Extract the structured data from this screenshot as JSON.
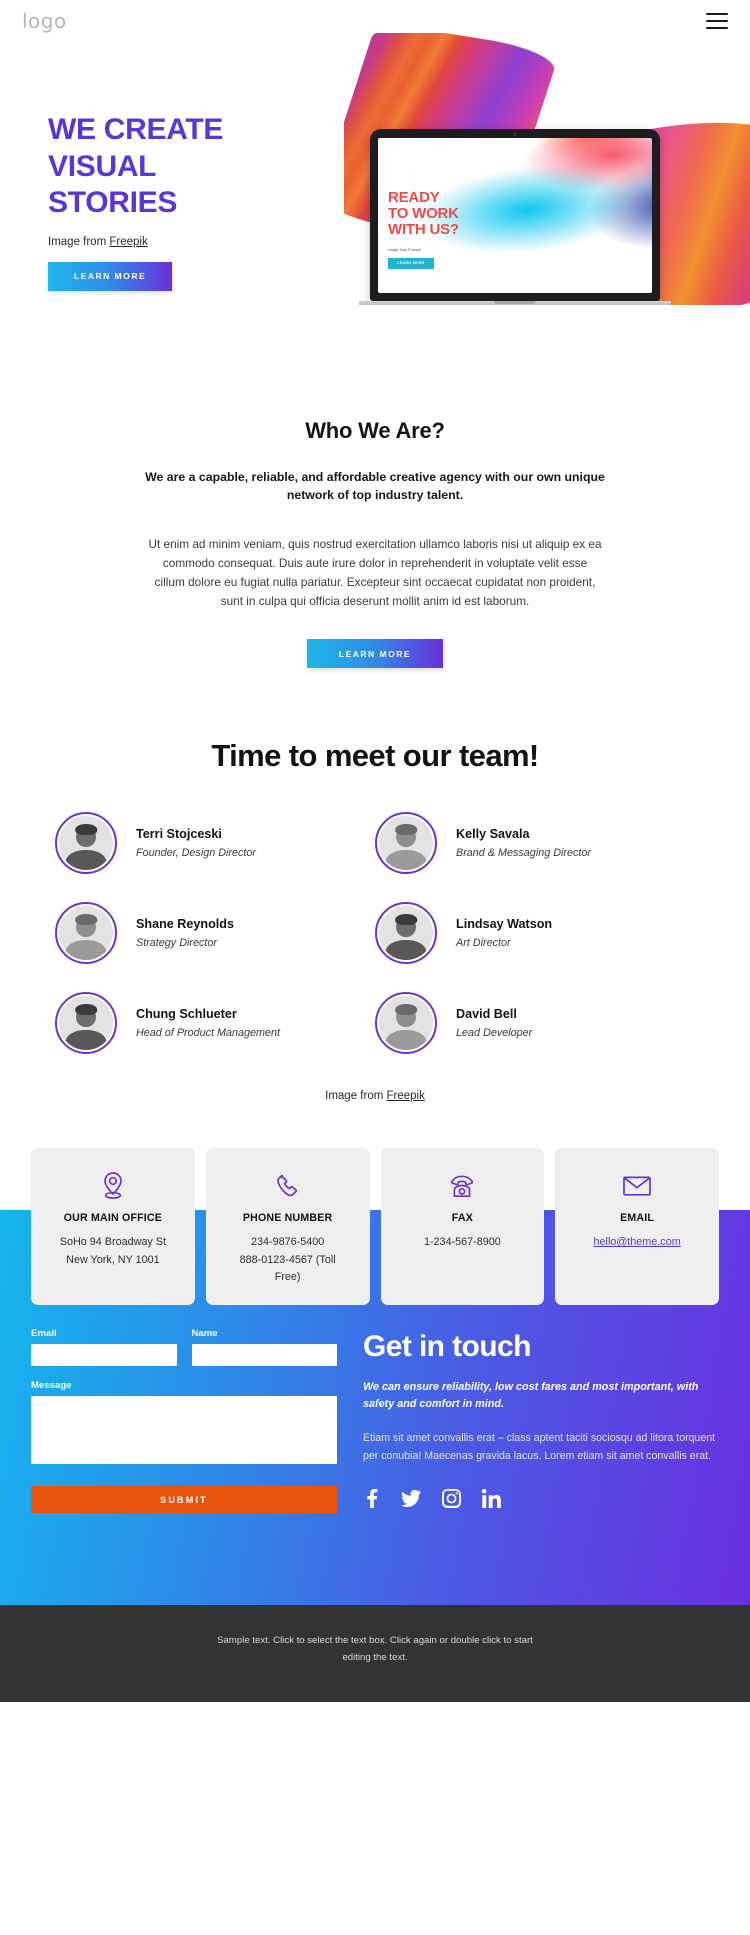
{
  "header": {
    "logo": "logo",
    "menu_icon": "hamburger-menu-icon"
  },
  "hero": {
    "title_line1": "WE CREATE",
    "title_line2": "VISUAL",
    "title_line3": "STORIES",
    "credit_prefix": "Image from ",
    "credit_link": "Freepik",
    "cta": "LEARN MORE",
    "accent_color": "#5b35d5",
    "device": {
      "screen_line1": "READY",
      "screen_line2": "TO WORK",
      "screen_line3": "WITH US?",
      "screen_credit": "Image from Freepik",
      "screen_button": "LEARN MORE"
    }
  },
  "about": {
    "heading": "Who We Are?",
    "lead": "We are a capable, reliable, and affordable creative agency with our own unique network of top industry talent.",
    "body": "Ut enim ad minim veniam, quis nostrud exercitation ullamco laboris nisi ut aliquip ex ea commodo consequat. Duis aute irure dolor in reprehenderit in voluptate velit esse cillum dolore eu fugiat nulla pariatur. Excepteur sint occaecat cupidatat non proident, sunt in culpa qui officia deserunt mollit anim id est laborum.",
    "cta": "LEARN MORE"
  },
  "team": {
    "heading": "Time to meet our team!",
    "credit_prefix": "Image from ",
    "credit_link": "Freepik",
    "ring_color": "#6a33d6",
    "members": [
      {
        "name": "Terri Stojceski",
        "role": "Founder, Design Director"
      },
      {
        "name": "Kelly Savala",
        "role": "Brand & Messaging Director"
      },
      {
        "name": "Shane Reynolds",
        "role": "Strategy Director"
      },
      {
        "name": "Lindsay Watson",
        "role": "Art Director"
      },
      {
        "name": "Chung Schlueter",
        "role": "Head of Product Management"
      },
      {
        "name": "David Bell",
        "role": "Lead Developer"
      }
    ]
  },
  "contact_cards": [
    {
      "icon": "map-pin-icon",
      "title": "OUR MAIN OFFICE",
      "line1": "SoHo 94 Broadway St",
      "line2": "New York, NY 1001",
      "line3": ""
    },
    {
      "icon": "phone-handset-icon",
      "title": "PHONE NUMBER",
      "line1": "234-9876-5400",
      "line2": "888-0123-4567 (Toll",
      "line3": "Free)"
    },
    {
      "icon": "fax-machine-icon",
      "title": "FAX",
      "line1": "1-234-567-8900",
      "line2": "",
      "line3": ""
    },
    {
      "icon": "envelope-icon",
      "title": "EMAIL",
      "line1_link": "hello@theme.com",
      "line2": "",
      "line3": ""
    }
  ],
  "get_in_touch": {
    "heading": "Get in touch",
    "lead": "We can ensure reliability, low cost fares and most important, with safety and comfort in mind.",
    "body": "Etiam sit amet convallis erat – class aptent taciti sociosqu ad litora torquent per conubia! Maecenas gravida lacus. Lorem etiam sit amet convallis erat.",
    "form": {
      "email_label": "Email",
      "email_value": "",
      "email_placeholder": "",
      "name_label": "Name",
      "name_value": "",
      "name_placeholder": "",
      "message_label": "Message",
      "message_value": "",
      "message_placeholder": "",
      "submit_label": "SUBMIT",
      "submit_color": "#e8540d"
    },
    "socials": [
      {
        "name": "facebook-icon"
      },
      {
        "name": "twitter-icon"
      },
      {
        "name": "instagram-icon"
      },
      {
        "name": "linkedin-icon"
      }
    ],
    "gradient_start": "#15b6ed",
    "gradient_end": "#6a2fe0"
  },
  "footer": {
    "text": "Sample text. Click to select the text box. Click again or double click to start editing the text.",
    "background": "#333333"
  }
}
